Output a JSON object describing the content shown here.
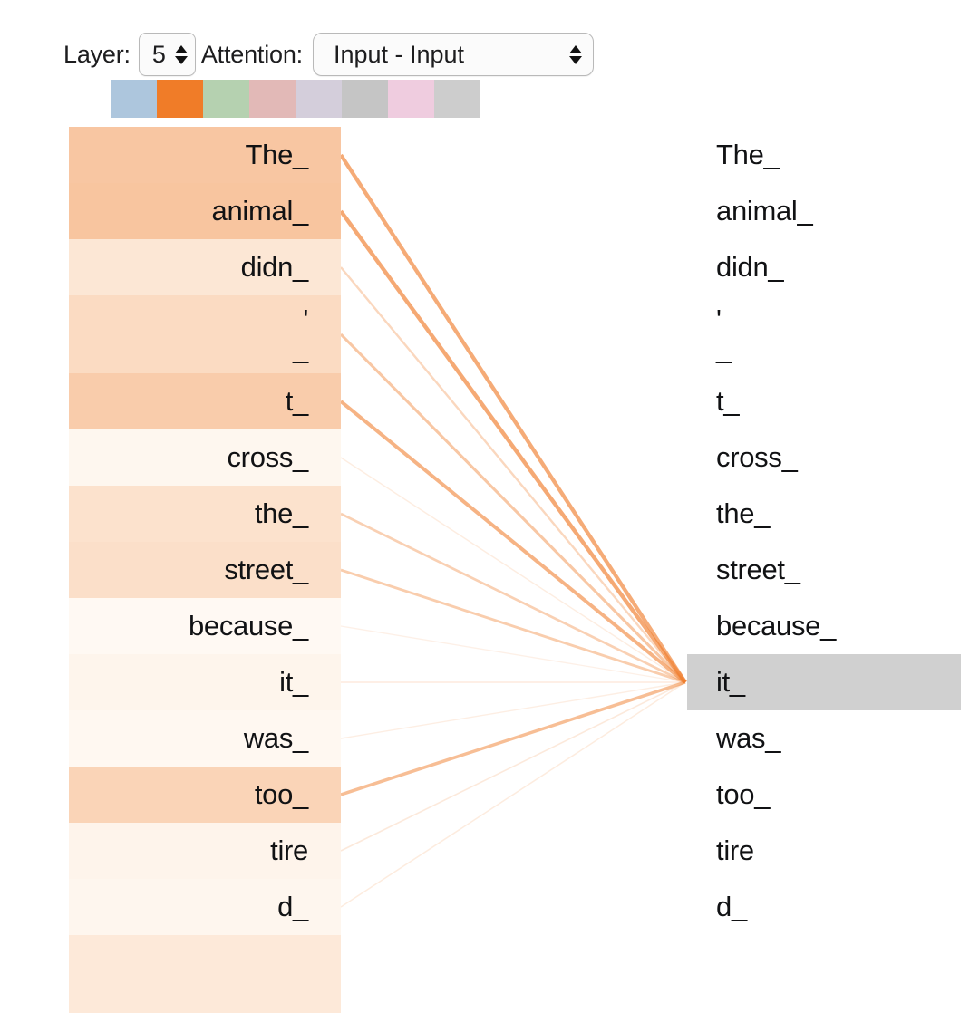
{
  "header": {
    "layer_label": "Layer:",
    "layer_value": "5",
    "attention_label": "Attention:",
    "attention_value": "Input - Input",
    "attention_options": [
      "Input - Input"
    ]
  },
  "legend": {
    "swatches": [
      {
        "name": "head-1",
        "color": "#adc6dd"
      },
      {
        "name": "head-2",
        "color": "#f07c28"
      },
      {
        "name": "head-3",
        "color": "#b5d1b0"
      },
      {
        "name": "head-4",
        "color": "#e2b9b7"
      },
      {
        "name": "head-5",
        "color": "#d4cedb"
      },
      {
        "name": "head-6",
        "color": "#c5c5c5"
      },
      {
        "name": "head-7",
        "color": "#efccdf"
      },
      {
        "name": "head-8",
        "color": "#cdcdcd"
      }
    ]
  },
  "chart_data": {
    "type": "attention-bipartite",
    "title": "BERT attention: Input - Input, Layer 5",
    "selected_target_index": 9,
    "selected_target_token": "it_",
    "link_color": "#f08031",
    "highlight_color": "#d0d0d0",
    "source_tokens": [
      "The_",
      "animal_",
      "didn_",
      "'\n_",
      "t_",
      "cross_",
      "the_",
      "street_",
      "because_",
      "it_",
      "was_",
      "too_",
      "tire",
      "d_",
      ""
    ],
    "target_tokens": [
      "The_",
      "animal_",
      "didn_",
      "'\n_",
      "t_",
      "cross_",
      "the_",
      "street_",
      "because_",
      "it_",
      "was_",
      "too_",
      "tire",
      "d_"
    ],
    "source_weights": [
      0.62,
      0.64,
      0.24,
      0.38,
      0.55,
      0.05,
      0.3,
      0.33,
      0.02,
      0.07,
      0.04,
      0.46,
      0.08,
      0.06,
      0.21
    ],
    "source_row_heights": [
      62,
      62,
      62,
      86,
      62,
      62,
      62,
      62,
      62,
      62,
      62,
      62,
      62,
      62,
      86
    ],
    "link_weights": [
      0.62,
      0.64,
      0.24,
      0.38,
      0.55,
      0.05,
      0.3,
      0.33,
      0.02,
      0.07,
      0.04,
      0.46,
      0.08,
      0.06
    ],
    "xlabel": "",
    "ylabel": "",
    "legend_position": "top"
  }
}
